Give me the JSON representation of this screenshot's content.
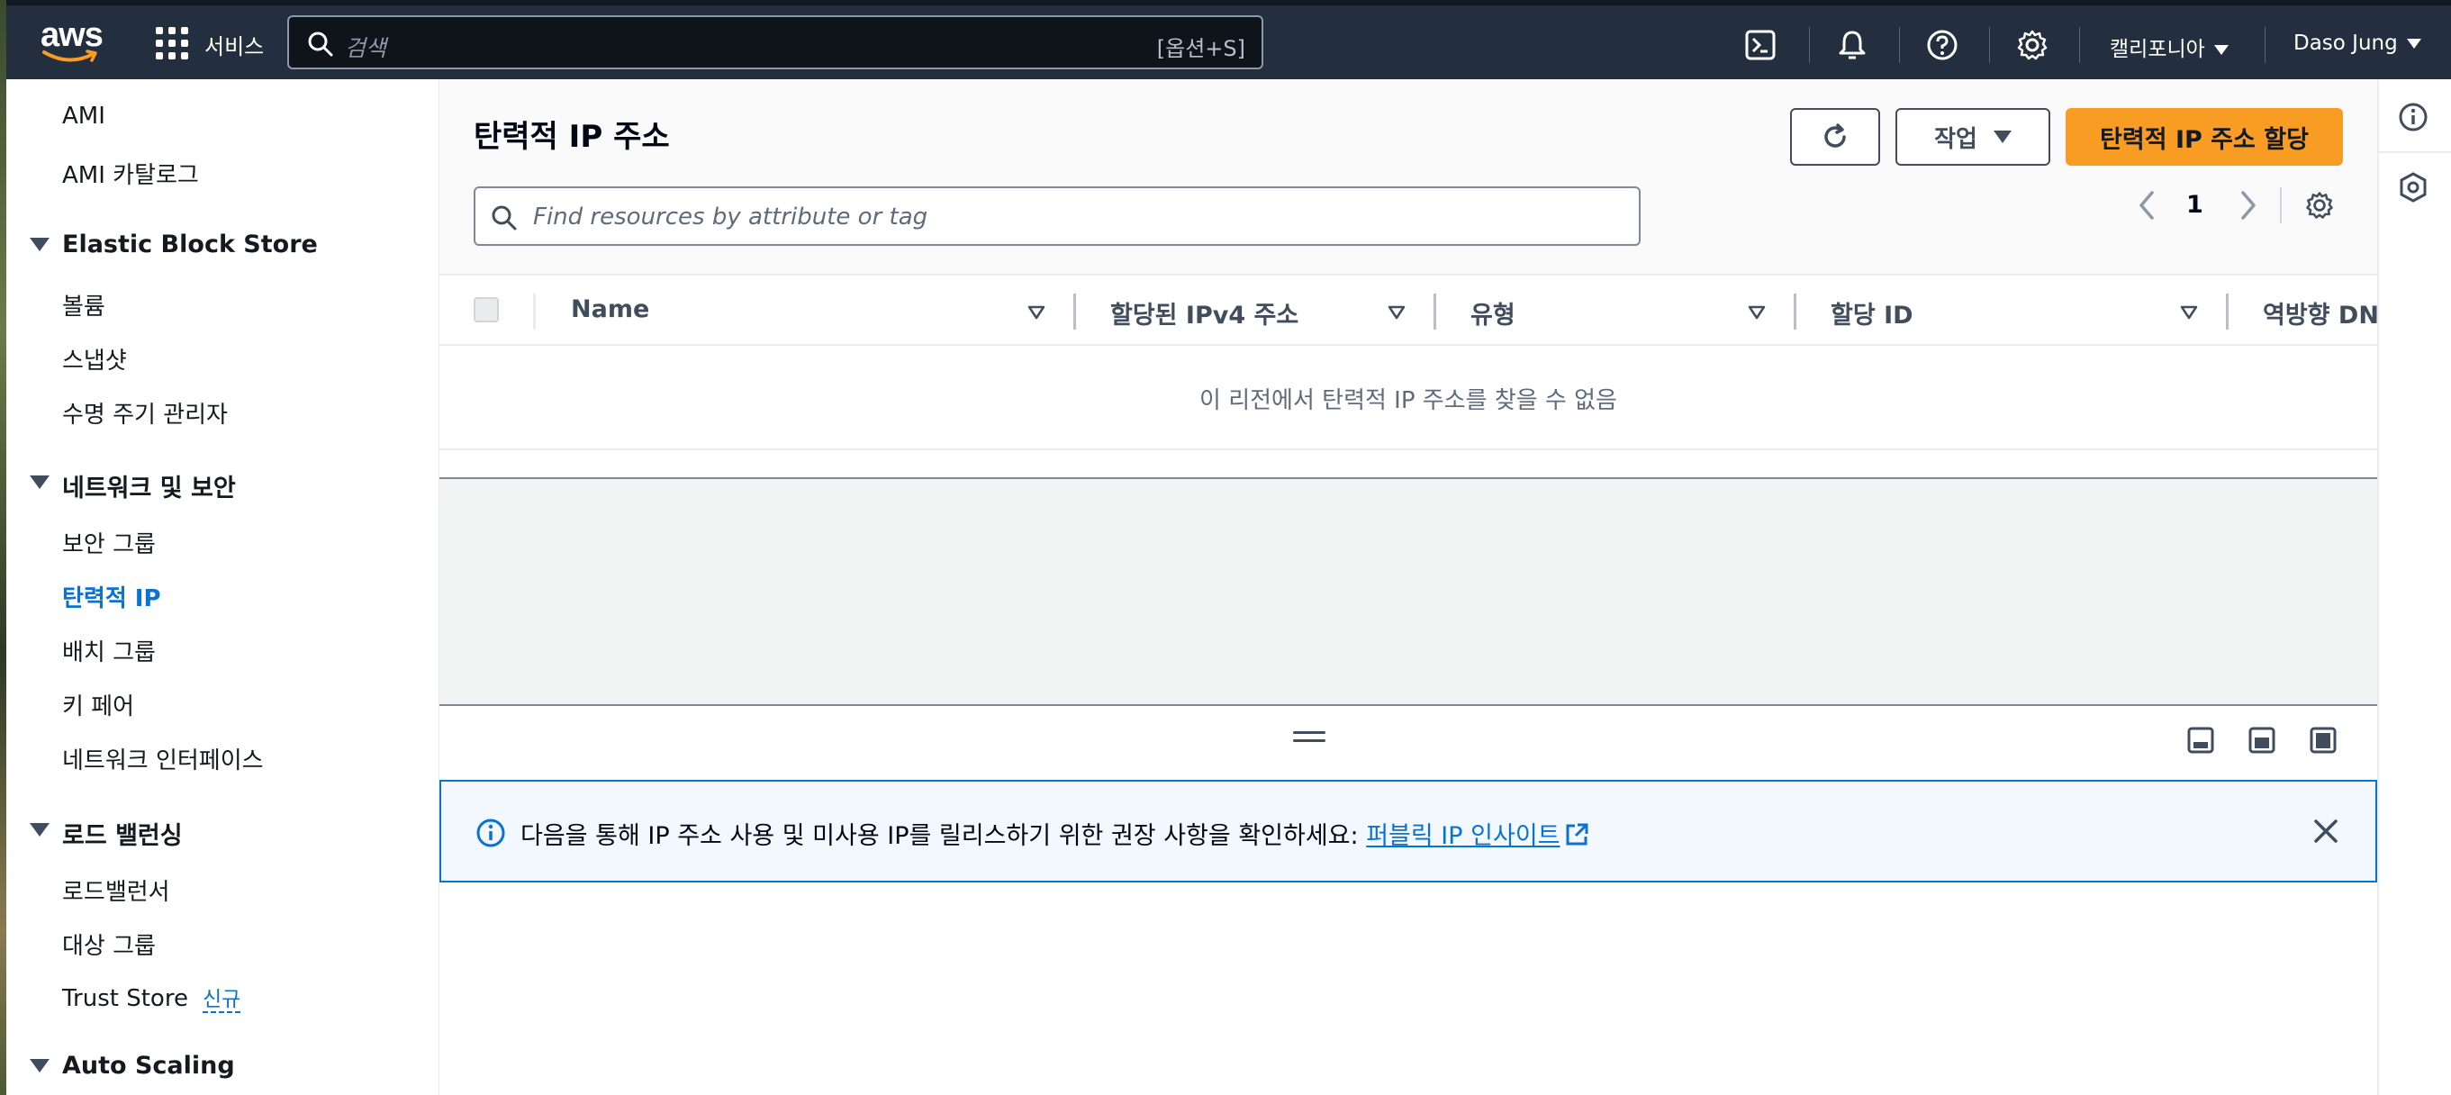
{
  "nav": {
    "brand": "aws",
    "services_label": "서비스",
    "search_placeholder": "검색",
    "search_shortcut": "[옵션+S]",
    "region": "캘리포니아",
    "user": "Daso Jung"
  },
  "sidebar": {
    "items_top": [
      "AMI",
      "AMI 카탈로그"
    ],
    "sections": [
      {
        "title": "Elastic Block Store",
        "items": [
          "볼륨",
          "스냅샷",
          "수명 주기 관리자"
        ]
      },
      {
        "title": "네트워크 및 보안",
        "items": [
          "보안 그룹",
          "탄력적 IP",
          "배치 그룹",
          "키 페어",
          "네트워크 인터페이스"
        ]
      },
      {
        "title": "로드 밸런싱",
        "items": [
          "로드밸런서",
          "대상 그룹",
          "Trust Store"
        ]
      },
      {
        "title": "Auto Scaling",
        "items": []
      }
    ],
    "active_item": "탄력적 IP",
    "new_badge": "신규"
  },
  "main": {
    "title": "탄력적 IP 주소",
    "actions_label": "작업",
    "allocate_label": "탄력적 IP 주소 할당",
    "filter_placeholder": "Find resources by attribute or tag",
    "page_number": "1",
    "columns": [
      "Name",
      "할당된 IPv4 주소",
      "유형",
      "할당 ID",
      "역방향 DNS"
    ],
    "empty_message": "이 리전에서 탄력적 IP 주소를 찾을 수 없음"
  },
  "flash": {
    "message": "다음을 통해 IP 주소 사용 및 미사용 IP를 릴리스하기 위한 권장 사항을 확인하세요: ",
    "link_label": "퍼블릭 IP 인사이트"
  },
  "colors": {
    "nav_bg": "#232f3e",
    "primary": "#f89c24",
    "link": "#0972d3",
    "flash_bg": "#f2f8fd"
  }
}
